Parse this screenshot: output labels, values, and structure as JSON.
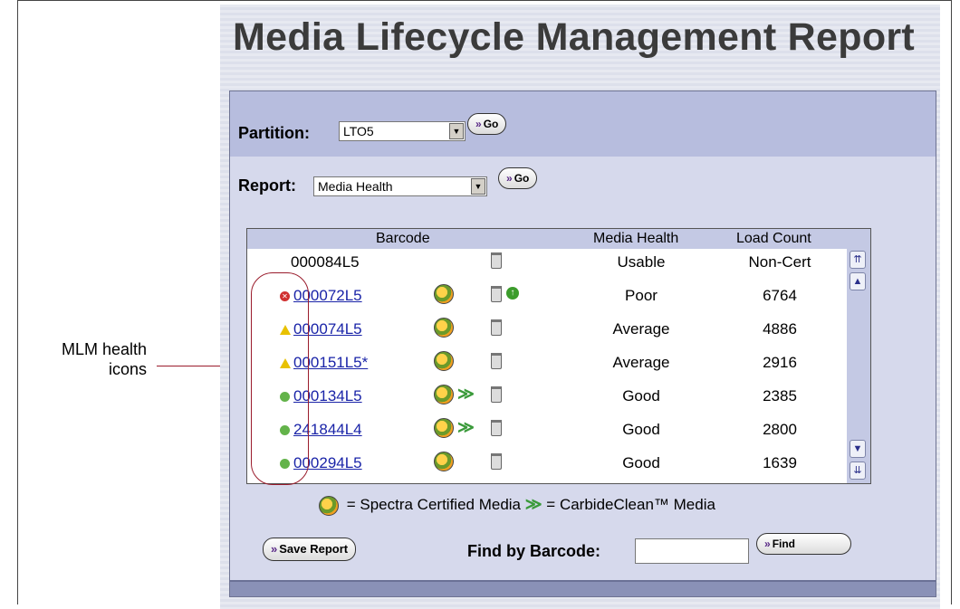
{
  "page_title": "Media Lifecycle Management Report",
  "partition": {
    "label": "Partition:",
    "value": "LTO5",
    "go_label": "Go"
  },
  "report": {
    "label": "Report:",
    "value": "Media Health",
    "go_label": "Go"
  },
  "table": {
    "columns": [
      "Barcode",
      "Media Health",
      "Load Count"
    ],
    "rows": [
      {
        "health_icon": "none",
        "barcode": "000084L5",
        "link": false,
        "certified": false,
        "carbideclean": false,
        "upgrade": false,
        "media_health": "Usable",
        "load_count": "Non-Cert"
      },
      {
        "health_icon": "error-icon",
        "barcode": "000072L5",
        "link": true,
        "certified": true,
        "carbideclean": false,
        "upgrade": true,
        "media_health": "Poor",
        "load_count": "6764"
      },
      {
        "health_icon": "warning-icon",
        "barcode": "000074L5",
        "link": true,
        "certified": true,
        "carbideclean": false,
        "upgrade": false,
        "media_health": "Average",
        "load_count": "4886"
      },
      {
        "health_icon": "warning-icon",
        "barcode": "000151L5*",
        "link": true,
        "certified": true,
        "carbideclean": false,
        "upgrade": false,
        "media_health": "Average",
        "load_count": "2916"
      },
      {
        "health_icon": "good-icon",
        "barcode": "000134L5",
        "link": true,
        "certified": true,
        "carbideclean": true,
        "upgrade": false,
        "media_health": "Good",
        "load_count": "2385"
      },
      {
        "health_icon": "good-icon",
        "barcode": "241844L4",
        "link": true,
        "certified": true,
        "carbideclean": true,
        "upgrade": false,
        "media_health": "Good",
        "load_count": "2800"
      },
      {
        "health_icon": "good-icon",
        "barcode": "000294L5",
        "link": true,
        "certified": true,
        "carbideclean": false,
        "upgrade": false,
        "media_health": "Good",
        "load_count": "1639"
      }
    ]
  },
  "legend": {
    "certified_text": " = Spectra Certified Media ",
    "carbideclean_text": " = CarbideClean™ Media"
  },
  "save_report_label": "Save Report",
  "find": {
    "label": "Find by Barcode:",
    "button_label": "Find",
    "value": ""
  },
  "callout": {
    "text": "MLM health icons"
  },
  "colors": {
    "link": "#1a24a8",
    "panel_header": "#b7bdde",
    "callout": "#9a1c2c"
  }
}
